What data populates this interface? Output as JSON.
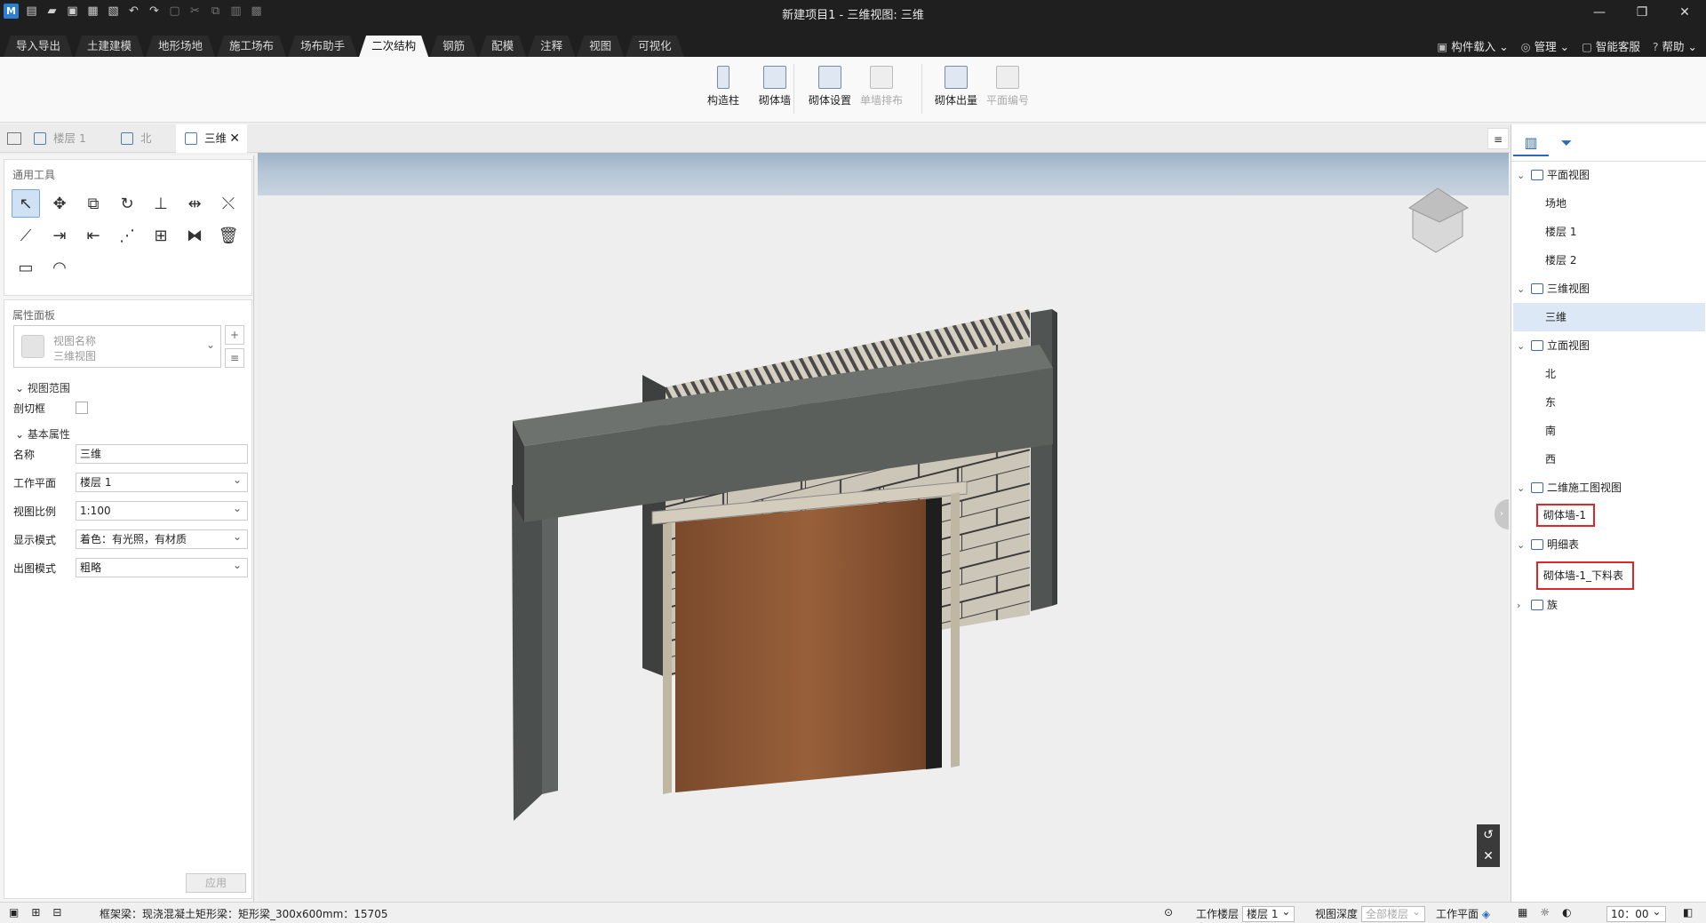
{
  "window": {
    "title": "新建项目1 - 三维视图: 三维",
    "minimize": "—",
    "restore": "❐",
    "close": "✕"
  },
  "quick_access": [
    "new",
    "open",
    "save",
    "save-as",
    "export",
    "undo",
    "redo",
    "select",
    "cut",
    "copy",
    "paste",
    "delete"
  ],
  "menu_tabs": [
    "导入导出",
    "土建建模",
    "地形场地",
    "施工场布",
    "场布助手",
    "二次结构",
    "钢筋",
    "配模",
    "注释",
    "视图",
    "可视化"
  ],
  "active_menu_tab": "二次结构",
  "top_right": {
    "component_load": "构件载入",
    "manage": "管理",
    "service": "智能客服",
    "help": "帮助"
  },
  "ribbon": {
    "tools": [
      {
        "label": "构造柱",
        "enabled": true
      },
      {
        "label": "砌体墙",
        "enabled": true
      },
      {
        "label": "砌体设置",
        "enabled": true
      },
      {
        "label": "单墙排布",
        "enabled": false
      },
      {
        "label": "砌体出量",
        "enabled": true
      },
      {
        "label": "平面编号",
        "enabled": false
      }
    ]
  },
  "doc_tabs": [
    {
      "label": "楼层 1",
      "active": false
    },
    {
      "label": "北",
      "active": false
    },
    {
      "label": "三维",
      "active": true
    }
  ],
  "left_panel": {
    "tools_title": "通用工具",
    "tools": [
      "select-arrow",
      "move",
      "copy",
      "rotate",
      "align",
      "split",
      "trim",
      "offset",
      "extend",
      "break",
      "array",
      "group",
      "mirror",
      "delete",
      "measure",
      "measure-angle"
    ],
    "properties_title": "属性面板",
    "view_name_label": "视图名称",
    "view_name_value": "三维视图",
    "group_view_range": "视图范围",
    "section_box_label": "剖切框",
    "group_basic": "基本属性",
    "props": [
      {
        "label": "名称",
        "value": "三维",
        "dropdown": false
      },
      {
        "label": "工作平面",
        "value": "楼层 1",
        "dropdown": true
      },
      {
        "label": "视图比例",
        "value": "1:100",
        "dropdown": true
      },
      {
        "label": "显示模式",
        "value": "着色：有光照，有材质",
        "dropdown": true
      },
      {
        "label": "出图模式",
        "value": "粗略",
        "dropdown": true
      }
    ],
    "apply_label": "应用"
  },
  "tree": {
    "plan_views": "平面视图",
    "plan_items": [
      "场地",
      "楼层 1",
      "楼层 2"
    ],
    "views_3d": "三维视图",
    "views_3d_items": [
      "三维"
    ],
    "elevations": "立面视图",
    "elevation_items": [
      "北",
      "东",
      "南",
      "西"
    ],
    "construction_2d": "二维施工图视图",
    "construction_items": [
      "砌体墙-1"
    ],
    "schedules": "明细表",
    "schedule_items": [
      "砌体墙-1_下料表"
    ],
    "families": "族"
  },
  "status": {
    "message": "框架梁：现浇混凝土矩形梁：矩形梁_300x600mm：15705",
    "work_floor_label": "工作楼层",
    "work_floor_value": "楼层 1",
    "view_depth_label": "视图深度",
    "view_depth_value": "全部楼层",
    "work_plane_label": "工作平面",
    "time_value": "10：00"
  },
  "colors": {
    "accent": "#2a6ab8",
    "highlight": "#e0262a",
    "dark_bar": "#1f1f1f"
  }
}
